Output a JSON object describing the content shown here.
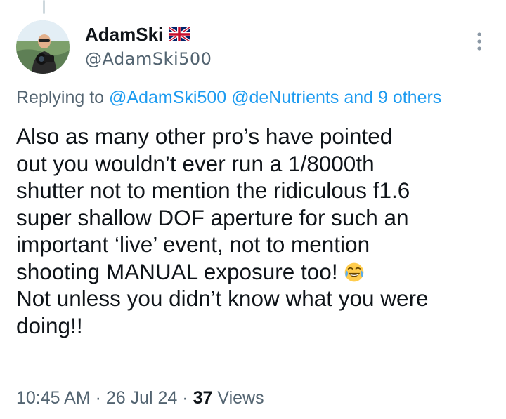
{
  "author": {
    "display_name": "AdamSki",
    "flag_icon": "uk-flag-icon",
    "handle": "@AdamSki500"
  },
  "reply": {
    "prefix": "Replying to ",
    "mention_1": "@AdamSki500",
    "mention_2": "@deNutrients",
    "others": "and 9 others"
  },
  "tweet": {
    "lines": [
      "Also as many other pro’s have pointed",
      "out you wouldn’t ever run a 1/8000th",
      "shutter not to mention the ridiculous f1.6",
      "super shallow DOF aperture for such an",
      "important ‘live’ event, not to mention",
      "shooting MANUAL exposure too!",
      "Not unless you didn’t know what you were",
      "doing!!"
    ],
    "emoji_icon": "tears-of-joy-emoji-icon"
  },
  "meta": {
    "time": "10:45 AM",
    "separator": "·",
    "date": "26 Jul 24",
    "views_count": "37",
    "views_label": "Views"
  },
  "colors": {
    "text": "#0f1419",
    "secondary": "#536471",
    "link": "#1d9bf0"
  }
}
